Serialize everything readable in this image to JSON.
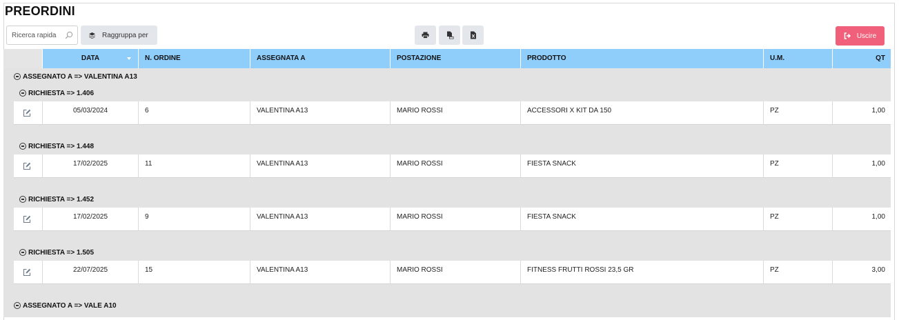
{
  "page": {
    "title": "PREORDINI"
  },
  "toolbar": {
    "search_placeholder": "Ricerca rapida",
    "group_label": "Raggruppa per",
    "exit_label": "Uscire",
    "accent_color": "#f0607a",
    "header_color": "#8fcdfb"
  },
  "table": {
    "columns": [
      "DATA",
      "N. ORDINE",
      "ASSEGNATA A",
      "POSTAZIONE",
      "PRODOTTO",
      "U.M.",
      "QT"
    ],
    "groups": [
      {
        "label": "ASSEGNATO A => VALENTINA A13",
        "subgroups": [
          {
            "label": "RICHIESTA => 1.406",
            "rows": [
              {
                "data": "05/03/2024",
                "ordine": "6",
                "assegnata": "VALENTINA A13",
                "postazione": "MARIO ROSSI",
                "prodotto": "ACCESSORI X KIT DA 150",
                "um": "PZ",
                "qt": "1,00"
              }
            ]
          },
          {
            "label": "RICHIESTA => 1.448",
            "rows": [
              {
                "data": "17/02/2025",
                "ordine": "11",
                "assegnata": "VALENTINA A13",
                "postazione": "MARIO ROSSI",
                "prodotto": "FIESTA SNACK",
                "um": "PZ",
                "qt": "1,00"
              }
            ]
          },
          {
            "label": "RICHIESTA => 1.452",
            "rows": [
              {
                "data": "17/02/2025",
                "ordine": "9",
                "assegnata": "VALENTINA A13",
                "postazione": "MARIO ROSSI",
                "prodotto": "FIESTA SNACK",
                "um": "PZ",
                "qt": "1,00"
              }
            ]
          },
          {
            "label": "RICHIESTA => 1.505",
            "rows": [
              {
                "data": "22/07/2025",
                "ordine": "15",
                "assegnata": "VALENTINA A13",
                "postazione": "MARIO ROSSI",
                "prodotto": "FITNESS FRUTTI ROSSI 23,5 GR",
                "um": "PZ",
                "qt": "3,00"
              }
            ]
          }
        ]
      },
      {
        "label": "ASSEGNATO A => VALE A10",
        "subgroups": []
      }
    ]
  }
}
